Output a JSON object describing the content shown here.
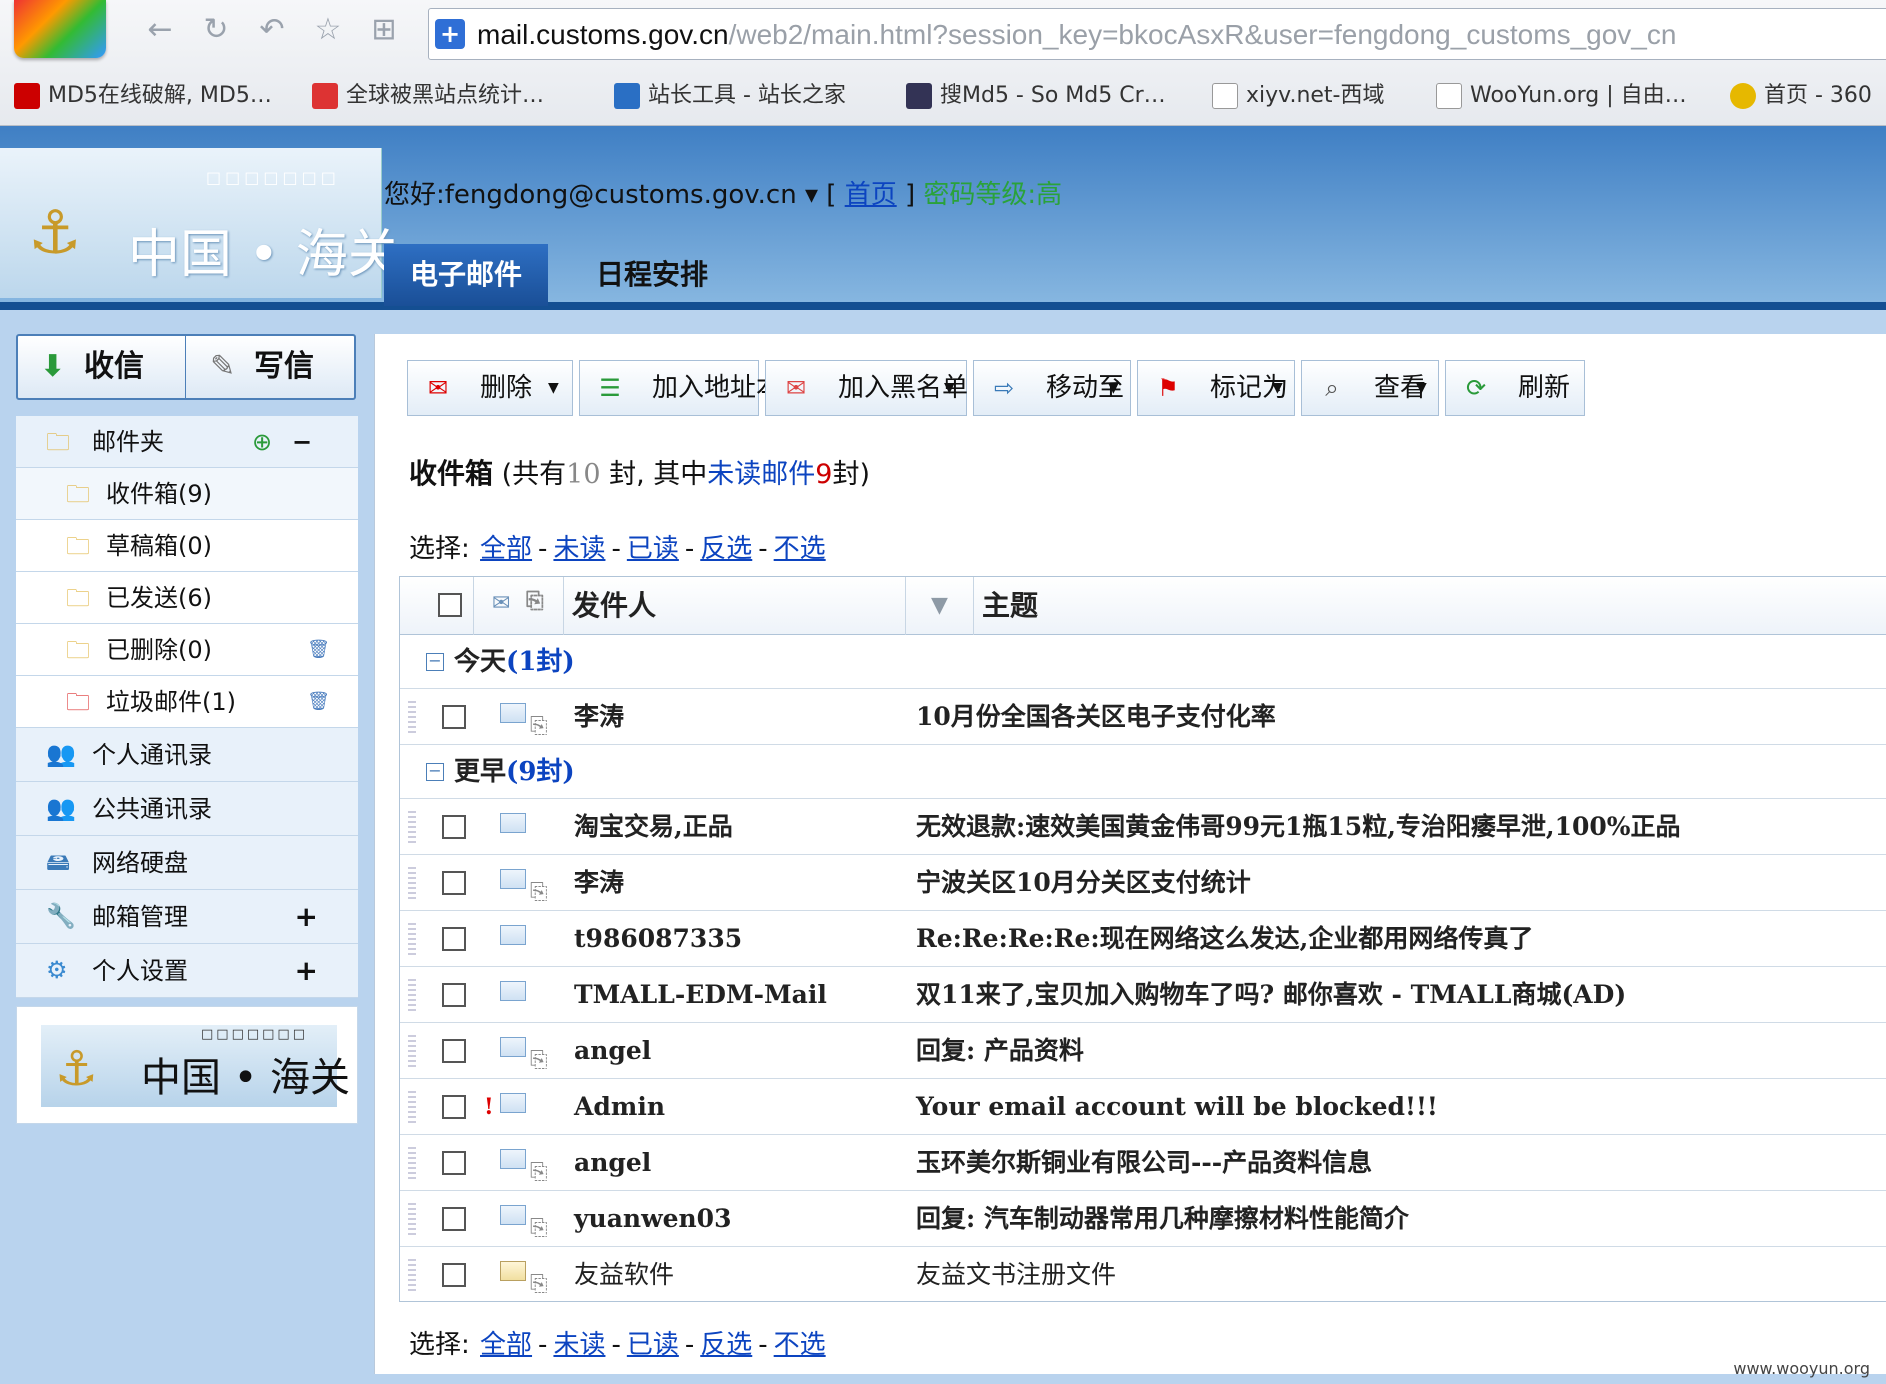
{
  "browser": {
    "url_host": "mail.customs.gov.cn",
    "url_rest": "/web2/main.html?session_key=bkocAsxR&user=fengdong_customs_gov_cn",
    "bookmarks": [
      {
        "label": "MD5在线破解, MD5…",
        "color": "#c00"
      },
      {
        "label": "全球被黑站点统计…",
        "color": "#d33"
      },
      {
        "label": "站长工具 - 站长之家",
        "color": "#2a6fc4"
      },
      {
        "label": "搜Md5 - So Md5 Cr…",
        "color": "#335"
      },
      {
        "label": "xiyv.net-西域",
        "color": "#eee"
      },
      {
        "label": "WooYun.org | 自由…",
        "color": "#eee"
      },
      {
        "label": "首页 - 360",
        "color": "#e6b800"
      }
    ]
  },
  "header": {
    "logo_squares": "□□□□□□□",
    "logo_text": "中国 • 海关",
    "greeting_prefix": "您好:",
    "user_email": "fengdong@customs.gov.cn",
    "dropdown": "▾",
    "bracket_open": "[",
    "home_link": "首页",
    "bracket_close": "]",
    "password_level": "密码等级:高",
    "tabs": [
      "电子邮件",
      "日程安排"
    ]
  },
  "sidebar": {
    "receive": "收信",
    "compose": "写信",
    "folders_label": "邮件夹",
    "folders": [
      {
        "label": "收件箱(9)"
      },
      {
        "label": "草稿箱(0)"
      },
      {
        "label": "已发送(6)"
      },
      {
        "label": "已删除(0)"
      },
      {
        "label": "垃圾邮件(1)"
      }
    ],
    "items": [
      {
        "label": "个人通讯录"
      },
      {
        "label": "公共通讯录"
      },
      {
        "label": "网络硬盘"
      },
      {
        "label": "邮箱管理",
        "expand": "+"
      },
      {
        "label": "个人设置",
        "expand": "+"
      }
    ],
    "plus_minus": "−",
    "bottom_logo_text": "中国 • 海关",
    "bottom_logo_squares": "□□□□□□□"
  },
  "toolbar": {
    "buttons": [
      {
        "label": "删除",
        "dropdown": true
      },
      {
        "label": "加入地址本",
        "dropdown": false
      },
      {
        "label": "加入黑名单",
        "dropdown": true
      },
      {
        "label": "移动至",
        "dropdown": true
      },
      {
        "label": "标记为",
        "dropdown": true
      },
      {
        "label": "查看",
        "dropdown": true
      },
      {
        "label": "刷新",
        "dropdown": false
      }
    ]
  },
  "inbox": {
    "title": "收件箱",
    "info_prefix": "(共有",
    "total": "10",
    "info_mid": "封, 其中",
    "unread_label": "未读邮件",
    "unread": "9",
    "info_suffix": "封)"
  },
  "select": {
    "label": "选择:",
    "options": [
      "全部",
      "未读",
      "已读",
      "反选",
      "不选"
    ]
  },
  "table": {
    "col_from": "发件人",
    "col_subject": "主题",
    "groups": [
      {
        "label": "今天",
        "count": "(1封)"
      },
      {
        "label": "更早",
        "count": "(9封)"
      }
    ],
    "rows": [
      {
        "from": "李涛",
        "subject": "10月份全国各关区电子支付化率",
        "attach": true,
        "important": false,
        "read": false
      },
      {
        "from": "淘宝交易,正品",
        "subject": "无效退款:速效美国黄金伟哥99元1瓶15粒,专治阳痿早泄,100%正品",
        "attach": false,
        "important": false,
        "read": false
      },
      {
        "from": "李涛",
        "subject": "宁波关区10月分关区支付统计",
        "attach": true,
        "important": false,
        "read": false
      },
      {
        "from": "t986087335",
        "subject": "Re:Re:Re:Re:现在网络这么发达,企业都用网络传真了",
        "attach": false,
        "important": false,
        "read": false
      },
      {
        "from": "TMALL-EDM-Mail",
        "subject": "双11来了,宝贝加入购物车了吗? 邮你喜欢 - TMALL商城(AD)",
        "attach": false,
        "important": false,
        "read": false
      },
      {
        "from": "angel",
        "subject": "回复: 产品资料",
        "attach": true,
        "important": false,
        "read": false
      },
      {
        "from": "Admin",
        "subject": "Your email account will be blocked!!!",
        "attach": false,
        "important": true,
        "read": false
      },
      {
        "from": "angel",
        "subject": "玉环美尔斯铜业有限公司---产品资料信息",
        "attach": true,
        "important": false,
        "read": false
      },
      {
        "from": "yuanwen03",
        "subject": "回复: 汽车制动器常用几种摩擦材料性能简介",
        "attach": true,
        "important": false,
        "read": false
      },
      {
        "from": "友益软件",
        "subject": "友益文书注册文件",
        "attach": true,
        "important": false,
        "read": true
      }
    ]
  },
  "watermark": "www.wooyun.org"
}
